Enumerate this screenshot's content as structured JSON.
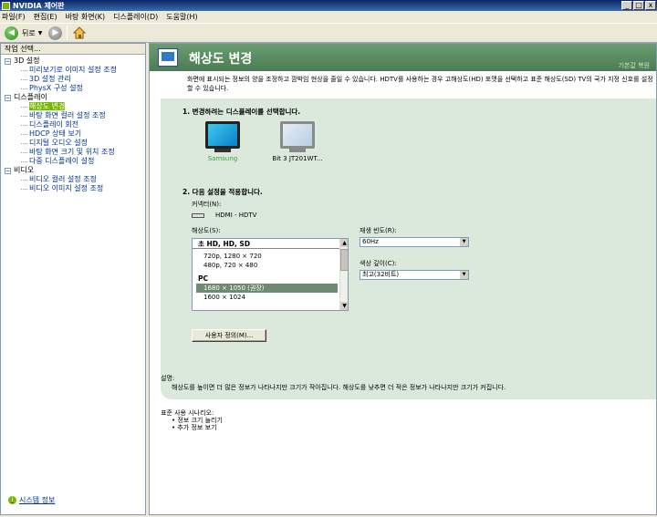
{
  "window": {
    "title": "NVIDIA 제어판",
    "minimize": "_",
    "maximize": "□",
    "close": "x"
  },
  "menu": [
    "파일(F)",
    "편집(E)",
    "바탕 화면(K)",
    "디스플레이(D)",
    "도움말(H)"
  ],
  "toolbar": {
    "back_label": "뒤로"
  },
  "left_panel": {
    "header": "작업 선택...",
    "categories": [
      {
        "label": "3D 설정",
        "items": [
          "미리보기로 이미지 설정 조정",
          "3D 설정 관리",
          "PhysX 구성 설정"
        ]
      },
      {
        "label": "디스플레이",
        "items": [
          "해상도 변경",
          "바탕 화면 컬러 설정 조정",
          "디스플레이 회전",
          "HDCP 상태 보기",
          "디지털 오디오 설정",
          "바탕 화면 크기 및 위치 조정",
          "다중 디스플레이 설정"
        ]
      },
      {
        "label": "비디오",
        "items": [
          "비디오 컬러 설정 조정",
          "비디오 이미지 설정 조정"
        ]
      }
    ],
    "selected": "해상도 변경",
    "system_info": "시스템 정보"
  },
  "page": {
    "title": "해상도 변경",
    "restore_defaults": "기본값 복원",
    "intro": "화면에 표시되는 정보의 양을 조정하고 깜박임 현상을 줄일 수 있습니다. HDTV를 사용하는 경우 고해상도(HD) 포맷을 선택하고 표준 해상도(SD) TV의 국가 지정 신호를 설정할 수 있습니다.",
    "step1": "1. 변경하려는 디스플레이를 선택합니다.",
    "displays": [
      {
        "name": "Samsung",
        "selected": true
      },
      {
        "name": "Bit 3 JT201WT..."
      }
    ],
    "step2": "2. 다음 설정을 적용합니다.",
    "connector_label": "커넥터(N):",
    "connector_value": "HDMI - HDTV",
    "resolution_label": "해상도(S):",
    "resolution_groups": [
      {
        "name": "초 HD, HD, SD",
        "items": [
          "720p, 1280 × 720",
          "480p, 720 × 480"
        ]
      },
      {
        "name": "PC",
        "items": [
          "1680 × 1050 (권장)",
          "1600 × 1024"
        ]
      }
    ],
    "selected_resolution": "1680 × 1050 (권장)",
    "refresh_label": "재생 빈도(R):",
    "refresh_value": "60Hz",
    "color_depth_label": "색상 깊이(C):",
    "color_depth_value": "최고(32비트)",
    "custom_button": "사용자 정의(M)...",
    "description_label": "설명:",
    "description_text": "해상도를 높이면 더 많은 정보가 나타나지만 크기가 작아집니다. 해상도를 낮추면 더 적은 정보가 나타나지만 크기가 커집니다.",
    "scenarios_label": "표준 사용 시나리오:",
    "scenarios": [
      "정보 크기 늘리기",
      "추가 정보 보기"
    ]
  },
  "colors": {
    "nvidia_green": "#76b900",
    "banner": "#4c7b53",
    "content_bg": "#dbe9dc"
  }
}
